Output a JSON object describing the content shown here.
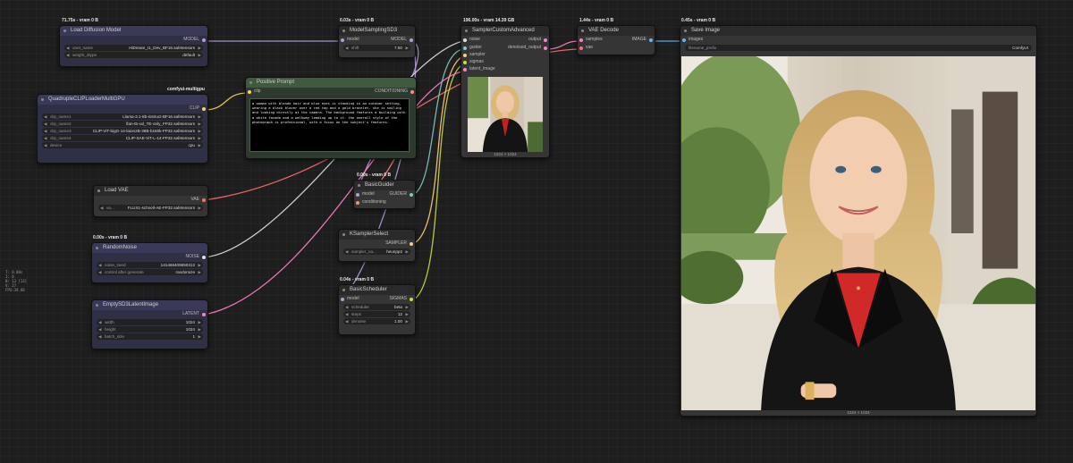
{
  "colors": {
    "model": "#b39ddb",
    "clip": "#ffd54f",
    "conditioning": "#ff8a80",
    "vae": "#ff6e6e",
    "latent": "#ff80c5",
    "image": "#64b5f6",
    "noise": "#cfcfcf",
    "sampler": "#ffcc80",
    "sigmas": "#cddc39",
    "guider": "#80cbc4"
  },
  "nodes": {
    "load_diffusion": {
      "badge": "71.75s - vram 0 B",
      "title": "Load Diffusion Model",
      "out_model": "MODEL",
      "w1_label": "unet_name",
      "w1_value": "HiDream_I1_Dev_BF16.safetensors",
      "w2_label": "weight_dtype",
      "w2_value": "default"
    },
    "quad_clip": {
      "badge": "comfyui-multigpu",
      "title": "QuadrupleCLIPLoaderMultiGPU",
      "out_clip": "CLIP",
      "w1_label": "clip_name1",
      "w1_value": "Llama-3.1-8b-instruct-BF16.safetensors",
      "w2_label": "clip_name2",
      "w2_value": "flan-t5-xxl_TE-only_FP32.safetensors",
      "w3_label": "clip_name3",
      "w3_value": "CLIP-ViT-bigG-14-laion2B-39B-b160k-FP32.safetensors",
      "w4_label": "clip_name4",
      "w4_value": "CLIP-SAE-ViT-L-14-FP32.safetensors",
      "w5_label": "device",
      "w5_value": "cpu"
    },
    "load_vae": {
      "title": "Load VAE",
      "out_vae": "VAE",
      "w1_label": "va...",
      "w1_value": "FLUX1-schnell-AE-FP32.safetensors"
    },
    "random_noise": {
      "badge": "0.00s - vram 0 B",
      "title": "RandomNoise",
      "out_noise": "NOISE",
      "w1_label": "noise_seed",
      "w1_value": "141466409650312",
      "w2_label": "control after generate",
      "w2_value": "randomize"
    },
    "empty_latent": {
      "title": "EmptySD3LatentImage",
      "out_latent": "LATENT",
      "w1_label": "width",
      "w1_value": "1024",
      "w2_label": "height",
      "w2_value": "1024",
      "w3_label": "batch_size",
      "w3_value": "1"
    },
    "model_sampling": {
      "badge": "0.03s - vram 0 B",
      "title": "ModelSamplingSD3",
      "in_model": "model",
      "out_model": "MODEL",
      "w1_label": "shift",
      "w1_value": "7.50"
    },
    "positive_prompt": {
      "title": "Positive Prompt",
      "in_clip": "clip",
      "out_cond": "CONDITIONING",
      "text": "a woman with blonde hair and blue eyes is standing in an outdoor setting, wearing a black blazer over a red top and a gold bracelet. she is smiling and looking directly at the camera. The background features a building with a white facade and a walkway leading up to it. the overall style of the photograph is professional, with a focus on the subject's features."
    },
    "basic_guider": {
      "badge": "0.00s - vram 0 B",
      "title": "BasicGuider",
      "in_model": "model",
      "in_cond": "conditioning",
      "out_guider": "GUIDER"
    },
    "ksampler_select": {
      "title": "KSamplerSelect",
      "out_sampler": "SAMPLER",
      "w1_label": "sampler_na...",
      "w1_value": "heunpp2"
    },
    "basic_scheduler": {
      "badge": "0.04s - vram 0 B",
      "title": "BasicScheduler",
      "in_model": "model",
      "out_sigmas": "SIGMAS",
      "w1_label": "scheduler",
      "w1_value": "beta",
      "w2_label": "steps",
      "w2_value": "12",
      "w3_label": "denoise",
      "w3_value": "1.00"
    },
    "sampler_custom": {
      "badge": "196.00s - vram 14.39 GB",
      "title": "SamplerCustomAdvanced",
      "in_noise": "noise",
      "in_guider": "guider",
      "in_sampler": "sampler",
      "in_sigmas": "sigmas",
      "in_latent": "latent_image",
      "out_output": "output",
      "out_denoised": "denoised_output",
      "dims": "1024 × 1024"
    },
    "vae_decode": {
      "badge": "1.44s - vram 0 B",
      "title": "VAE Decode",
      "in_samples": "samples",
      "in_vae": "vae",
      "out_image": "IMAGE"
    },
    "save_image": {
      "badge": "0.45s - vram 0 B",
      "title": "Save Image",
      "in_images": "images",
      "w1_label": "filename_prefix",
      "w1_value": "ComfyUI",
      "dims": "1024 × 1024"
    }
  },
  "stats": {
    "line1": "T: 0.00s",
    "line2": "I: 0",
    "line3": "N: 13 [13]",
    "line4": "V: 27",
    "line5": "FPS:39.68"
  }
}
